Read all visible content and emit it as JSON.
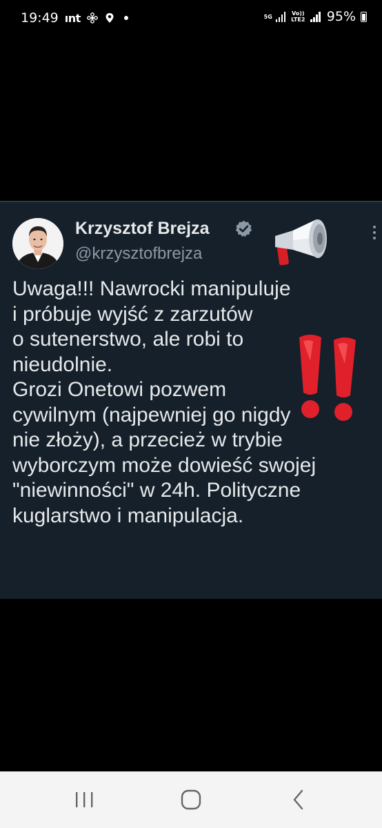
{
  "status_bar": {
    "time": "19:49",
    "carrier": "ınt",
    "network_5g": "5G",
    "network_volte": "Vo)) LTE2",
    "battery_percent": "95%"
  },
  "tweet": {
    "author_name": "Krzysztof Brejza",
    "handle": "@krzysztofbrejza",
    "verified": true,
    "text_lines": [
      "Uwaga!!! Nawrocki manipuluje",
      "i próbuje wyjść z zarzutów",
      "o sutenerstwo, ale robi to",
      "nieudolnie.",
      "Grozi Onetowi pozwem",
      "cywilnym (najpewniej go nigdy",
      "nie złoży), a przecież w trybie",
      "wyborczym może dowieść swojej",
      "\"niewinności\" w 24h. Polityczne",
      "kuglarstwo i manipulacja."
    ],
    "emoji": [
      "megaphone-icon",
      "double-exclamation-icon"
    ],
    "colors": {
      "background": "#15202b",
      "verified_badge": "#8b98a5",
      "emoji_red": "#e0202a"
    }
  },
  "nav_bar": {
    "buttons": [
      "recent-apps",
      "home",
      "back"
    ]
  }
}
